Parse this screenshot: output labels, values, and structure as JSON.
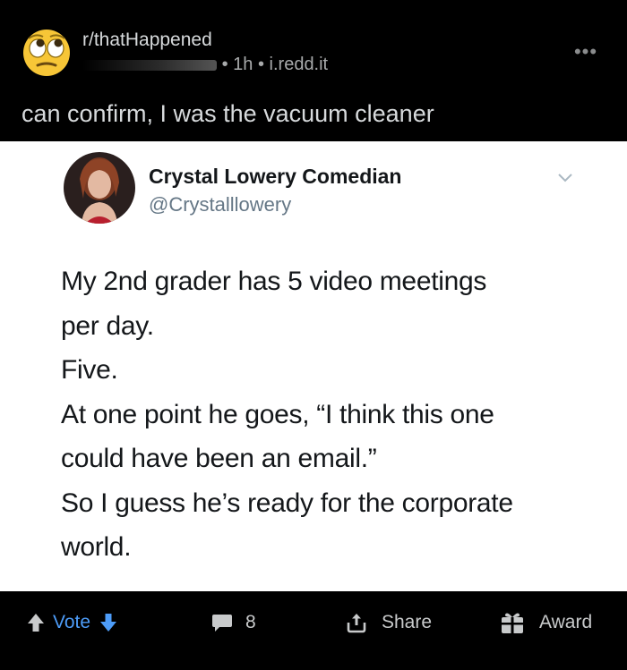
{
  "header": {
    "subreddit": "r/thatHappened",
    "meta_time": "1h",
    "meta_domain": "i.redd.it",
    "separator": "•",
    "more_label": "•••"
  },
  "post": {
    "title": "can confirm, I was the vacuum cleaner"
  },
  "tweet": {
    "display_name": "Crystal Lowery Comedian",
    "handle": "@Crystalllowery",
    "lines": [
      "My 2nd grader has 5 video meetings",
      "per day.",
      "Five.",
      "At one point he goes, “I think this one",
      "could have been an email.”",
      "So I guess he’s ready for the corporate",
      "world."
    ]
  },
  "actions": {
    "vote_label": "Vote",
    "comment_count": "8",
    "share_label": "Share",
    "award_label": "Award"
  },
  "colors": {
    "vote_accent": "#4d9cf8",
    "background": "#000000",
    "text": "#d7dadc"
  }
}
